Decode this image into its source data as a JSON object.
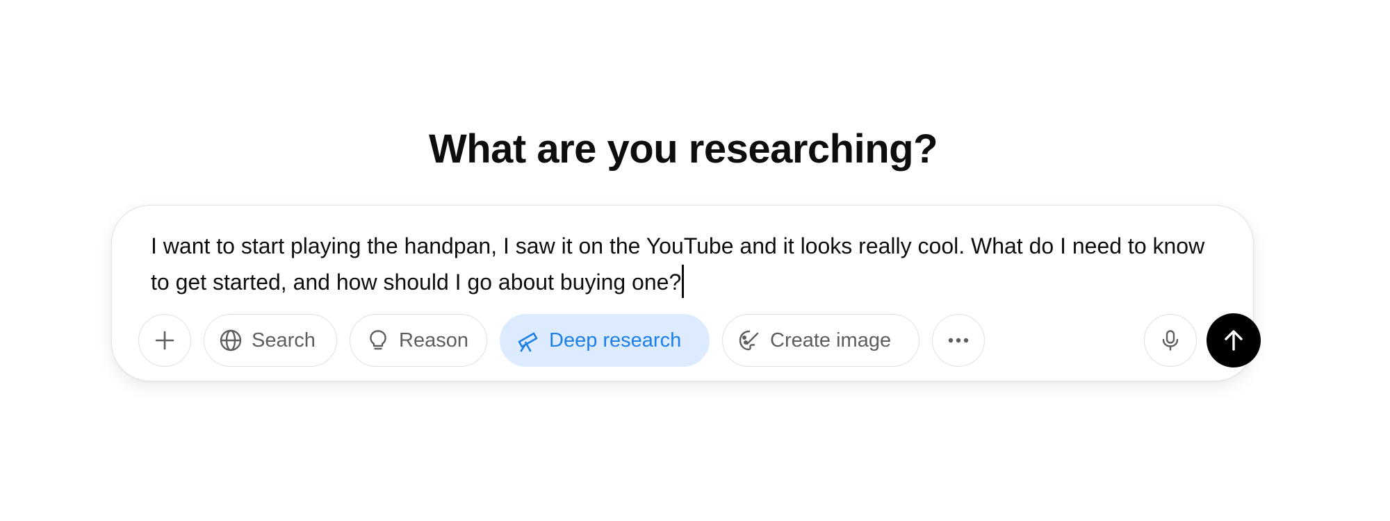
{
  "heading": "What are you researching?",
  "composer": {
    "prompt_text": "I want to start playing the handpan, I saw it on the YouTube and it looks really cool. What do I need to know to get started, and how should I go about buying one?"
  },
  "toolbar": {
    "add_icon": "plus-icon",
    "search_label": "Search",
    "search_icon": "globe-icon",
    "reason_label": "Reason",
    "reason_icon": "lightbulb-icon",
    "deep_research_label": "Deep research",
    "deep_research_icon": "telescope-icon",
    "deep_research_active": true,
    "create_image_label": "Create image",
    "create_image_icon": "palette-icon",
    "more_icon": "ellipsis-icon",
    "mic_icon": "microphone-icon",
    "send_icon": "arrow-up-icon"
  },
  "colors": {
    "active_pill_bg": "#dcebfd",
    "active_pill_text": "#1d7ee8",
    "send_button_bg": "#000000",
    "pill_border": "#e0e0e0"
  }
}
